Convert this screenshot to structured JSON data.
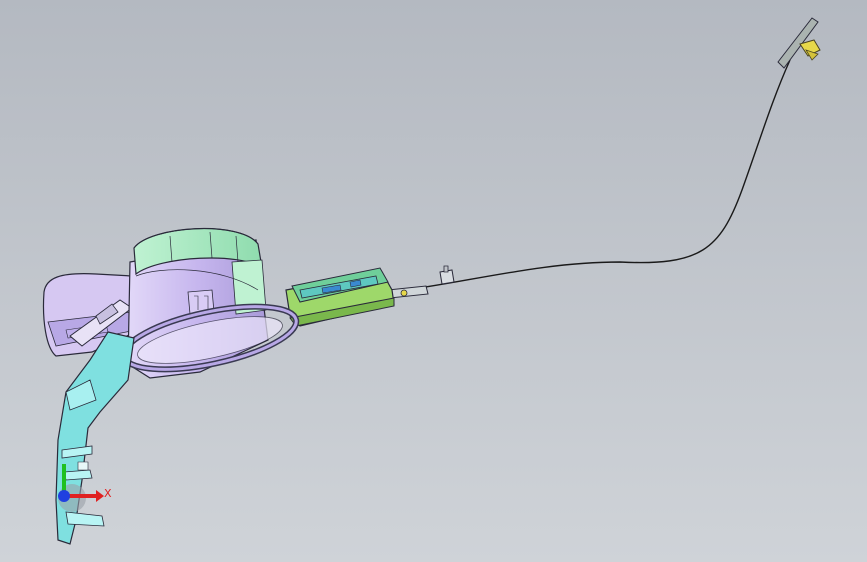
{
  "viewport": {
    "background_top": "#b4b9c1",
    "background_bottom": "#cfd3d8"
  },
  "triad": {
    "x_label": "X",
    "x_color": "#e02020",
    "y_color": "#20c020",
    "z_color": "#2040e0"
  },
  "model_colors": {
    "housing_top": "#a5eac0",
    "housing_side": "#c8b8ee",
    "housing_inner": "#d9ccf5",
    "flap": "#d6c8f2",
    "bracket": "#7fe0e0",
    "actuator": "#9ed86a",
    "actuator_body": "#6fcf9a",
    "latch": "#e6d84a",
    "cable": "#1a1a1a",
    "edge": "#2a2a3a"
  }
}
